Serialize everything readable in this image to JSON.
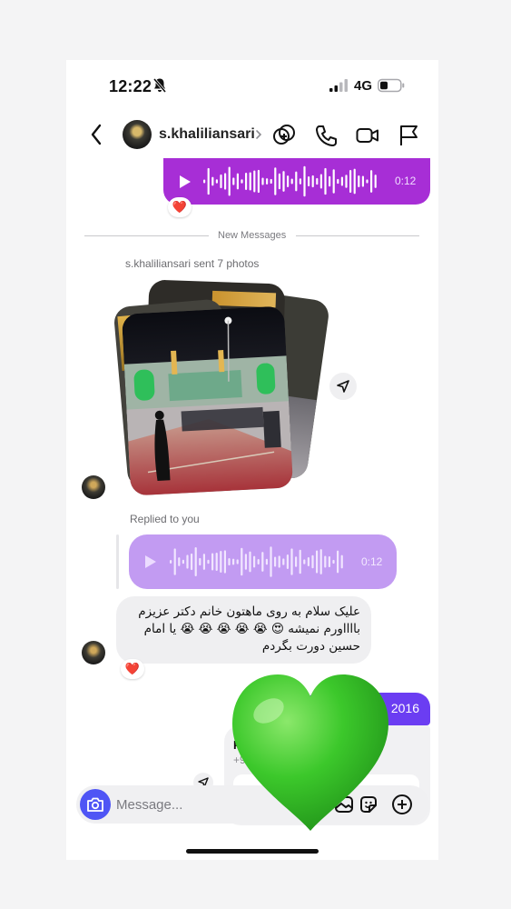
{
  "status_bar": {
    "time": "12:22",
    "network": "4G"
  },
  "header": {
    "username": "s.khaliliansari"
  },
  "messages": {
    "top_voice": {
      "duration": "0:12",
      "reaction": "❤️"
    },
    "divider": "New Messages",
    "photos_label": "s.khaliliansari sent 7 photos",
    "replied_label": "Replied to you",
    "reply_voice": {
      "duration": "0:12"
    },
    "text_message": {
      "lines": [
        "علیک سلام به روی ماهتون خانم دکتر عزیزم",
        "بااااورم نمیشه 😍 😭 😭 😭 😭 😭 یا امام",
        "حسین دورت بگردم"
      ],
      "reaction": "❤️"
    },
    "partial_bubble_text": "2016",
    "contact_card": {
      "name": "P",
      "phone": "+9"
    }
  },
  "composer": {
    "placeholder": "Message..."
  },
  "colors": {
    "voice_bubble": "#a72ed6",
    "reply_bubble": "#c29bf2",
    "accent_blue": "#4f55f5",
    "sent_bubble": "#6b3df2",
    "heart_sticker": "#38c229"
  },
  "sticker": {
    "icon": "green-heart-icon"
  }
}
